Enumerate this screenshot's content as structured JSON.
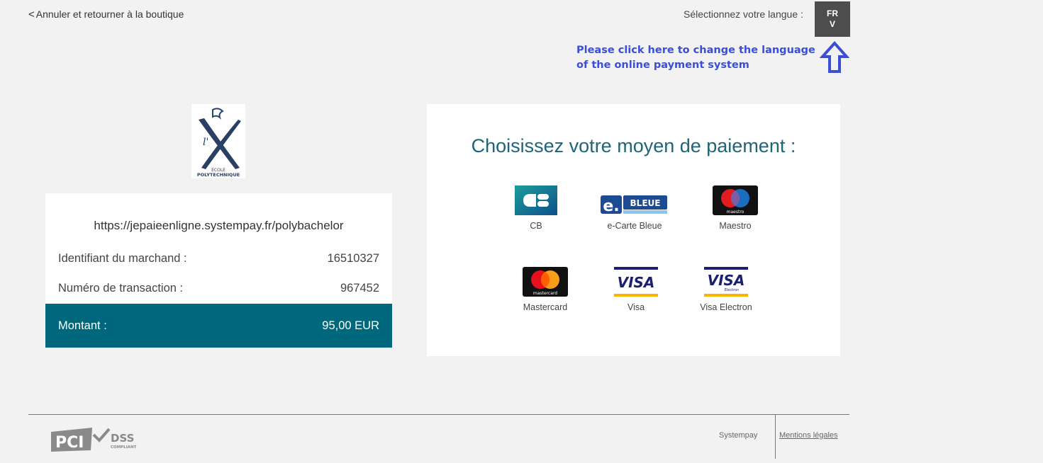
{
  "header": {
    "back_chevron": "<",
    "back_link": "Annuler et retourner à la boutique",
    "language_label": "Sélectionnez votre langue :",
    "language_code": "FR",
    "language_caret": "V"
  },
  "annotation": {
    "line1": "Please click here to change the language",
    "line2": "of the online payment system",
    "color": "#3a4ed6"
  },
  "merchant": {
    "logo_text_1": "ECOLE",
    "logo_text_2": "POLYTECHNIQUE",
    "url": "https://jepaieenligne.systempay.fr/polybachelor",
    "merchant_id_label": "Identifiant du marchand :",
    "merchant_id_value": "16510327",
    "transaction_label": "Numéro de transaction :",
    "transaction_value": "967452",
    "amount_label": "Montant :",
    "amount_value": "95,00 EUR",
    "accent_color": "#00687d"
  },
  "payment": {
    "title": "Choisissez votre moyen de paiement :",
    "methods": [
      {
        "label": "CB",
        "icon": "cb-icon"
      },
      {
        "label": "e-Carte Bleue",
        "icon": "e-carte-bleue-icon"
      },
      {
        "label": "Maestro",
        "icon": "maestro-icon"
      },
      {
        "label": "Mastercard",
        "icon": "mastercard-icon"
      },
      {
        "label": "Visa",
        "icon": "visa-icon"
      },
      {
        "label": "Visa Electron",
        "icon": "visa-electron-icon"
      }
    ],
    "logo_texts": {
      "ecb_bleue": "BLEUE",
      "maestro": "maestro",
      "mastercard": "mastercard",
      "visa": "VISA",
      "electron": "Electron"
    }
  },
  "footer": {
    "pci_logo": "PCI",
    "pci_dss": "DSS",
    "pci_compliant": "COMPLIANT",
    "systempay": "Systempay",
    "mentions": "Mentions légales"
  }
}
